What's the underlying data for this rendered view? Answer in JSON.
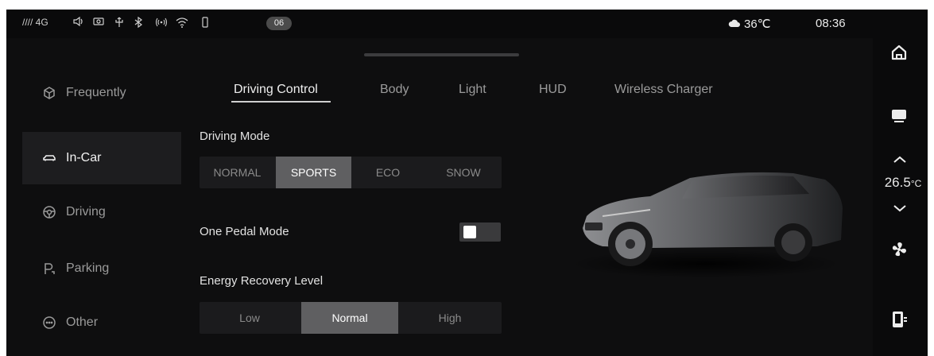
{
  "status_bar": {
    "signal": "//// 4G",
    "badge": "06",
    "weather_temp": "36℃",
    "time": "08:36",
    "icons": [
      "signal-icon",
      "speaker-icon",
      "camera-icon",
      "usb-icon",
      "bluetooth-icon",
      "hotspot-icon",
      "wifi-icon",
      "battery-icon",
      "weather-cloud-icon"
    ]
  },
  "sidebar": {
    "items": [
      {
        "label": "Frequently",
        "icon": "cube-icon"
      },
      {
        "label": "In-Car",
        "icon": "car-icon"
      },
      {
        "label": "Driving",
        "icon": "steering-icon"
      },
      {
        "label": "Parking",
        "icon": "parking-icon"
      },
      {
        "label": "Other",
        "icon": "more-icon"
      }
    ],
    "active_index": 1
  },
  "tabs": {
    "items": [
      "Driving Control",
      "Body",
      "Light",
      "HUD",
      "Wireless Charger"
    ],
    "active_index": 0
  },
  "driving_mode": {
    "label": "Driving Mode",
    "options": [
      "NORMAL",
      "SPORTS",
      "ECO",
      "SNOW"
    ],
    "selected": "SPORTS"
  },
  "one_pedal": {
    "label": "One Pedal Mode",
    "enabled": false
  },
  "energy_recovery": {
    "label": "Energy Recovery Level",
    "options": [
      "Low",
      "Normal",
      "High"
    ],
    "selected": "Normal"
  },
  "dock": {
    "cabin_temp": "26.5",
    "cabin_temp_unit": "°C",
    "icons": [
      "home-icon",
      "display-icon",
      "temp-up-icon",
      "temp-down-icon",
      "fan-icon",
      "app-switch-icon"
    ]
  },
  "colors": {
    "background": "#0e0e0f",
    "selected_segment": "#5f5f61",
    "segment_bg": "#1b1b1d",
    "text_active": "#eeeeee",
    "text_inactive": "#9b9b9b"
  }
}
